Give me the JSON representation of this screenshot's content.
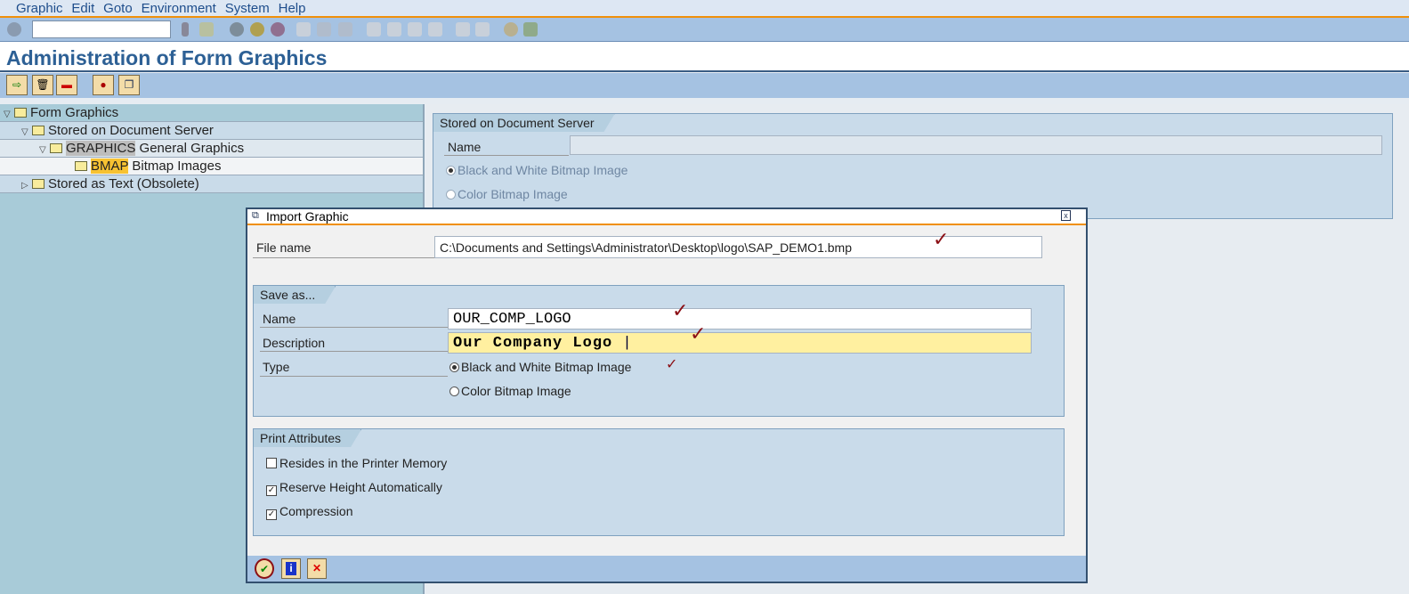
{
  "menu": [
    "Graphic",
    "Edit",
    "Goto",
    "Environment",
    "System",
    "Help"
  ],
  "title": "Administration of Form Graphics",
  "tree": [
    {
      "label": "Form Graphics",
      "level": 0,
      "expanded": true
    },
    {
      "label": "Stored on Document Server",
      "level": 1,
      "expanded": true
    },
    {
      "key": "GRAPHICS",
      "label": "General Graphics",
      "level": 2,
      "expanded": true
    },
    {
      "key": "BMAP",
      "label": "Bitmap Images",
      "level": 3
    },
    {
      "label": "Stored as Text (Obsolete)",
      "level": 1,
      "expanded": false
    }
  ],
  "right": {
    "frame_title": "Stored on Document Server",
    "name_label": "Name",
    "name_value": "",
    "radio_bw": "Black and White Bitmap Image",
    "radio_color": "Color Bitmap Image"
  },
  "dialog": {
    "title": "Import Graphic",
    "file_label": "File name",
    "file_value": "C:\\Documents and Settings\\Administrator\\Desktop\\logo\\SAP_DEMO1.bmp",
    "save_title": "Save as...",
    "name_label": "Name",
    "name_value": "OUR_COMP_LOGO",
    "desc_label": "Description",
    "desc_value": "Our Company Logo",
    "type_label": "Type",
    "type_bw": "Black and White Bitmap Image",
    "type_color": "Color Bitmap Image",
    "type_selected": "bw",
    "print_title": "Print Attributes",
    "opt_printer": "Resides in the Printer Memory",
    "opt_printer_checked": false,
    "opt_height": "Reserve Height Automatically",
    "opt_height_checked": true,
    "opt_comp": "Compression",
    "opt_comp_checked": true
  }
}
